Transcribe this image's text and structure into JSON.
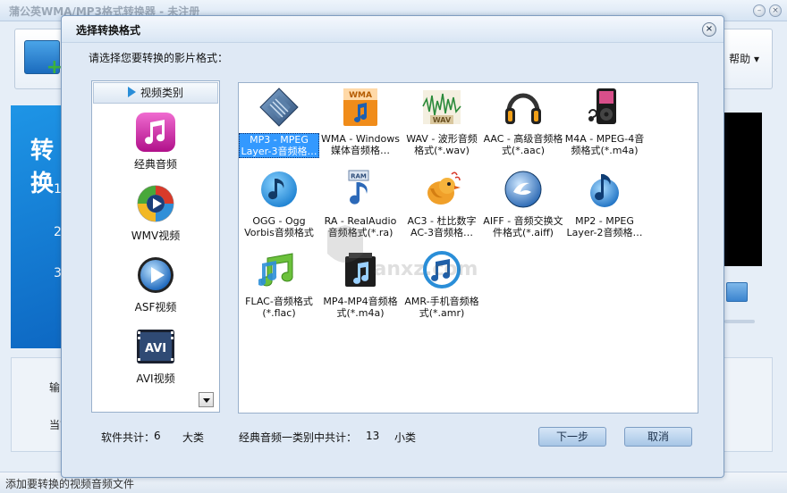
{
  "main_window": {
    "title": "蒲公英WMA/MP3格式转换器 - 未注册",
    "toolbar": {
      "help_label": "帮助"
    },
    "left_panel": {
      "heading": "转换",
      "steps": [
        "1.",
        "2.",
        "3."
      ]
    },
    "bottom_panel": {
      "output_label": "输出",
      "current_label": "当前"
    },
    "status_text": "添加要转换的视频音频文件"
  },
  "dialog": {
    "title": "选择转换格式",
    "close_glyph": "×",
    "prompt": "请选择您要转换的影片格式：",
    "category_header": "视频类别",
    "categories": [
      {
        "label": "经典音频",
        "icon": "music-note-icon"
      },
      {
        "label": "WMV视频",
        "icon": "wmv-icon"
      },
      {
        "label": "ASF视频",
        "icon": "asf-icon"
      },
      {
        "label": "AVI视频",
        "icon": "avi-icon"
      }
    ],
    "formats": [
      {
        "label": "MP3 - MPEG Layer-3音频格…",
        "icon": "mp3-icon",
        "selected": true
      },
      {
        "label": "WMA - Windows 媒体音频格…",
        "icon": "wma-icon"
      },
      {
        "label": "WAV - 波形音频格式(*.wav)",
        "icon": "wav-icon"
      },
      {
        "label": "AAC - 高级音频格式(*.aac)",
        "icon": "headphones-icon"
      },
      {
        "label": "M4A - MPEG-4音频格式(*.m4a)",
        "icon": "ipod-icon"
      },
      {
        "label": "OGG - Ogg Vorbis音频格式(*.ogg)",
        "icon": "ogg-icon"
      },
      {
        "label": "RA - RealAudio音频格式(*.ra)",
        "icon": "ram-icon"
      },
      {
        "label": "AC3 - 杜比数字AC-3音频格…",
        "icon": "bird-icon"
      },
      {
        "label": "AIFF - 音频交换文件格式(*.aiff)",
        "icon": "aiff-icon"
      },
      {
        "label": "MP2 - MPEG Layer-2音频格…",
        "icon": "mp2-icon"
      },
      {
        "label": "FLAC-音频格式(*.flac)",
        "icon": "flac-icon"
      },
      {
        "label": "MP4-MP4音频格式(*.m4a)",
        "icon": "mp4-icon"
      },
      {
        "label": "AMR-手机音频格式(*.amr)",
        "icon": "amr-icon"
      }
    ],
    "footer": {
      "software_total_label": "软件共计：",
      "software_total_count": "6",
      "category_unit": "大类",
      "subcategory_label": "经典音频一类别中共计：",
      "subcategory_count": "13",
      "subcategory_unit": "小类",
      "next_button": "下一步",
      "cancel_button": "取消"
    }
  },
  "watermark_text": "anxz.com"
}
